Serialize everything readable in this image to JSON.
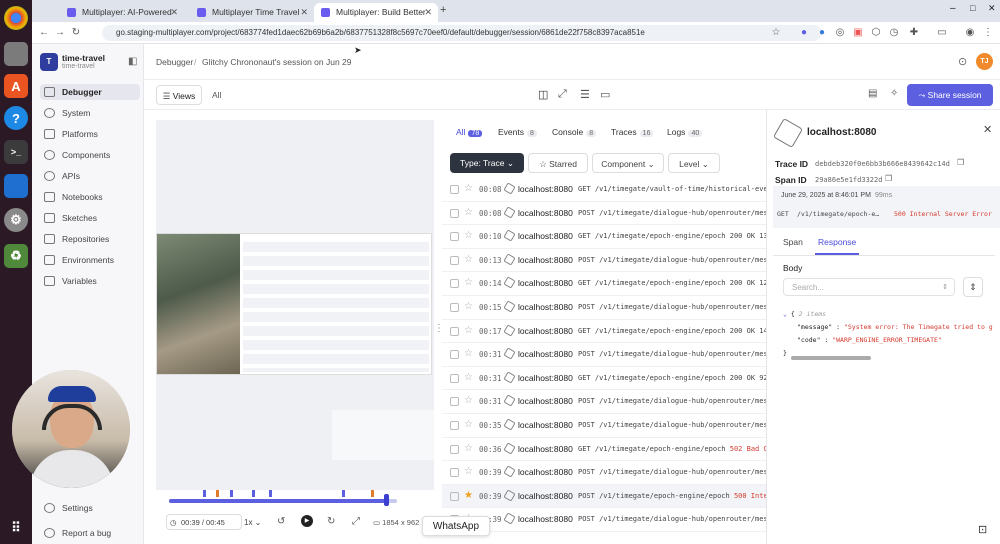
{
  "browser": {
    "tabs": [
      {
        "label": "Multiplayer: AI-Powered",
        "active": false
      },
      {
        "label": "Multiplayer Time Travel",
        "active": false
      },
      {
        "label": "Multiplayer: Build Better",
        "active": true
      }
    ],
    "url": "go.staging-multiplayer.com/project/683774fed1daec62b69b6a2b/6837751328f8c5697c70eef0/default/debugger/session/6861de22f758c8397aca851e",
    "new_tab": "+"
  },
  "sidebar": {
    "workspace_initial": "T",
    "workspace_name": "time-travel",
    "workspace_sub": "time-travel",
    "items": [
      {
        "label": "Debugger",
        "active": true
      },
      {
        "label": "System"
      },
      {
        "label": "Platforms"
      },
      {
        "label": "Components"
      },
      {
        "label": "APIs"
      },
      {
        "label": "Notebooks"
      },
      {
        "label": "Sketches"
      },
      {
        "label": "Repositories"
      },
      {
        "label": "Environments"
      },
      {
        "label": "Variables"
      }
    ],
    "settings": "Settings",
    "report_bug": "Report a bug"
  },
  "header": {
    "breadcrumb_root": "Debugger",
    "breadcrumb_sep": "/",
    "breadcrumb_current": "Glitchy Chrononaut's session on Jun 29",
    "avatar": "TJ"
  },
  "subbar": {
    "views": "Views",
    "all": "All",
    "share": "Share session"
  },
  "events": {
    "tabs": [
      {
        "label": "All",
        "count": "78",
        "active": true
      },
      {
        "label": "Events",
        "count": "8"
      },
      {
        "label": "Console",
        "count": "8"
      },
      {
        "label": "Traces",
        "count": "16"
      },
      {
        "label": "Logs",
        "count": "40"
      }
    ],
    "filter_type": "Type: Trace",
    "filter_starred": "Starred",
    "filter_component": "Component",
    "filter_level": "Level",
    "rows": [
      {
        "time": "00:08",
        "host": "localhost:8080",
        "method": "GET",
        "path": "/v1/timegate/vault-of-time/historical-even",
        "status": "",
        "error": false,
        "starred": false
      },
      {
        "time": "00:08",
        "host": "localhost:8080",
        "method": "POST",
        "path": "/v1/timegate/dialogue-hub/openrouter/mess",
        "status": "",
        "error": false,
        "starred": false
      },
      {
        "time": "00:10",
        "host": "localhost:8080",
        "method": "GET",
        "path": "/v1/timegate/epoch-engine/epoch",
        "status": "200 OK 13",
        "error": false,
        "starred": false
      },
      {
        "time": "00:13",
        "host": "localhost:8080",
        "method": "POST",
        "path": "/v1/timegate/dialogue-hub/openrouter/mess",
        "status": "",
        "error": false,
        "starred": false
      },
      {
        "time": "00:14",
        "host": "localhost:8080",
        "method": "GET",
        "path": "/v1/timegate/epoch-engine/epoch",
        "status": "200 OK 12",
        "error": false,
        "starred": false
      },
      {
        "time": "00:15",
        "host": "localhost:8080",
        "method": "POST",
        "path": "/v1/timegate/dialogue-hub/openrouter/mess",
        "status": "",
        "error": false,
        "starred": false
      },
      {
        "time": "00:17",
        "host": "localhost:8080",
        "method": "GET",
        "path": "/v1/timegate/epoch-engine/epoch",
        "status": "200 OK 14",
        "error": false,
        "starred": false
      },
      {
        "time": "00:31",
        "host": "localhost:8080",
        "method": "POST",
        "path": "/v1/timegate/dialogue-hub/openrouter/mess",
        "status": "",
        "error": false,
        "starred": false
      },
      {
        "time": "00:31",
        "host": "localhost:8080",
        "method": "GET",
        "path": "/v1/timegate/epoch-engine/epoch",
        "status": "200 OK 92",
        "error": false,
        "starred": false
      },
      {
        "time": "00:31",
        "host": "localhost:8080",
        "method": "POST",
        "path": "/v1/timegate/dialogue-hub/openrouter/mess",
        "status": "",
        "error": false,
        "starred": false
      },
      {
        "time": "00:35",
        "host": "localhost:8080",
        "method": "POST",
        "path": "/v1/timegate/dialogue-hub/openrouter/mess",
        "status": "",
        "error": false,
        "starred": false
      },
      {
        "time": "00:36",
        "host": "localhost:8080",
        "method": "GET",
        "path": "/v1/timegate/epoch-engine/epoch",
        "status": "502 Bad Ga",
        "error": true,
        "starred": false
      },
      {
        "time": "00:39",
        "host": "localhost:8080",
        "method": "POST",
        "path": "/v1/timegate/dialogue-hub/openrouter/mess",
        "status": "",
        "error": false,
        "starred": false
      },
      {
        "time": "00:39",
        "host": "localhost:8080",
        "method": "POST",
        "path": "/v1/timegate/epoch-engine/epoch",
        "status": "500 Intern",
        "error": true,
        "starred": true
      },
      {
        "time": "00:39",
        "host": "localhost:8080",
        "method": "POST",
        "path": "/v1/timegate/dialogue-hub/openrouter/mess",
        "status": "",
        "error": false,
        "starred": false
      }
    ]
  },
  "detail": {
    "title": "localhost:8080",
    "trace_label": "Trace ID",
    "trace_id": "debdeb320f0e6bb3b666e8439642c14d",
    "span_label": "Span ID",
    "span_id": "29a86e5e1fd3322d",
    "date": "June 29, 2025 at 8:46:01 PM",
    "duration": "99ms",
    "request_method": "GET",
    "request_path": "/v1/timegate/epoch-e…",
    "request_status": "500 Internal Server Error",
    "tab_span": "Span",
    "tab_response": "Response",
    "body_label": "Body",
    "search_placeholder": "Search...",
    "json_items": "2 items",
    "json_key_message": "\"message\"",
    "json_val_message": "\"System error: The Timegate tried to g",
    "json_key_code": "\"code\"",
    "json_val_code": "\"WARP_ENGINE_ERROR_TIMEGATE\""
  },
  "player": {
    "time": "00:39 / 00:45",
    "speed": "1x",
    "resolution": "1854 x 962"
  },
  "toast": "WhatsApp",
  "colors": {
    "accent": "#5b5fe0",
    "error": "#d43a2e",
    "dock": "#2b1a26"
  }
}
